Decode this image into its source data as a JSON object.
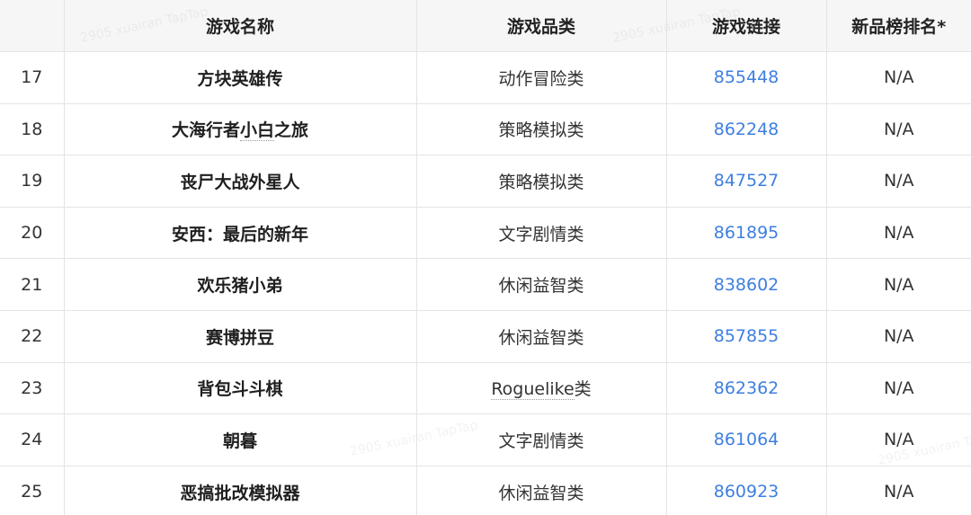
{
  "header": {
    "col_rank": "",
    "col_name": "游戏名称",
    "col_category": "游戏品类",
    "col_link": "游戏链接",
    "col_new_rank": "新品榜排名*"
  },
  "rows": [
    {
      "rank": "17",
      "name": "方块英雄传",
      "category": "动作冒险类",
      "link": "855448",
      "new_rank": "N/A"
    },
    {
      "rank": "18",
      "name_a": "大海行者",
      "name_b": "小白",
      "name_c": "之旅",
      "category": "策略模拟类",
      "link": "862248",
      "new_rank": "N/A"
    },
    {
      "rank": "19",
      "name": "丧尸大战外星人",
      "category": "策略模拟类",
      "link": "847527",
      "new_rank": "N/A"
    },
    {
      "rank": "20",
      "name": "安西：最后的新年",
      "category": "文字剧情类",
      "link": "861895",
      "new_rank": "N/A"
    },
    {
      "rank": "21",
      "name": "欢乐猪小弟",
      "category": "休闲益智类",
      "link": "838602",
      "new_rank": "N/A"
    },
    {
      "rank": "22",
      "name": "赛博拼豆",
      "category": "休闲益智类",
      "link": "857855",
      "new_rank": "N/A"
    },
    {
      "rank": "23",
      "name": "背包斗斗棋",
      "category_a": "Roguelike",
      "category_b": "类",
      "link": "862362",
      "new_rank": "N/A"
    },
    {
      "rank": "24",
      "name": "朝暮",
      "category": "文字剧情类",
      "link": "861064",
      "new_rank": "N/A"
    },
    {
      "rank": "25",
      "name": "恶搞批改模拟器",
      "category": "休闲益智类",
      "link": "860923",
      "new_rank": "N/A"
    }
  ],
  "watermark": "2905 xuairan TapTap",
  "colors": {
    "header_bg": "#f6f6f7",
    "border": "#e4e4e4",
    "link": "#3e7fe0"
  }
}
